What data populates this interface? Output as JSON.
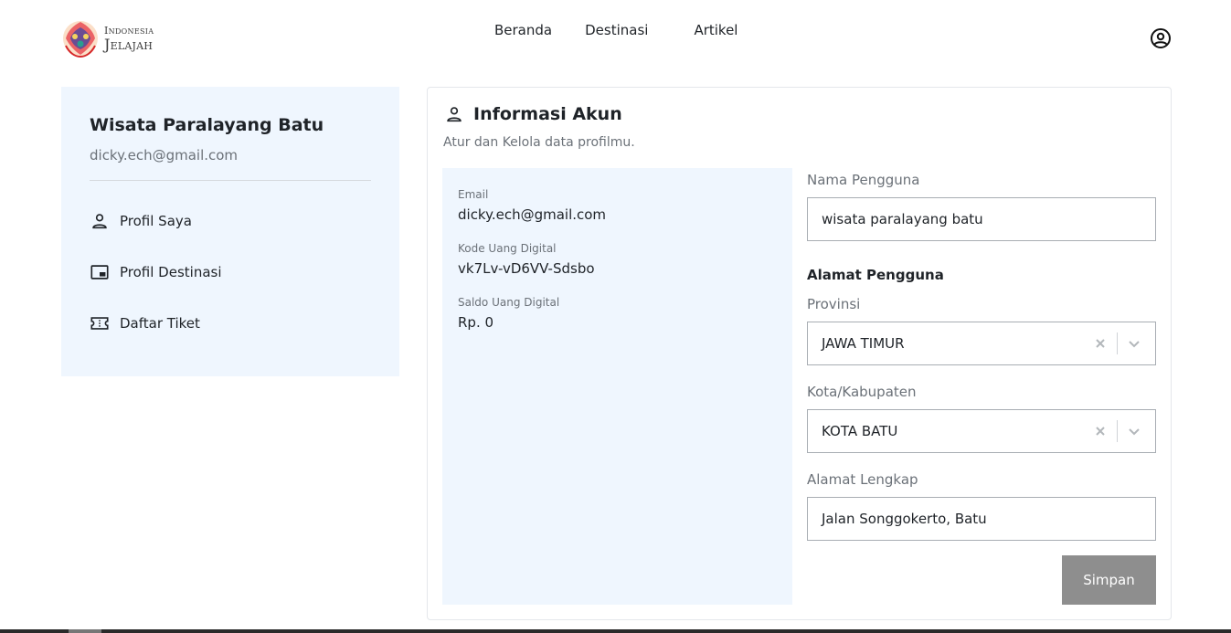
{
  "header": {
    "logo_line1": "Indonesia",
    "logo_line2": "Jelajah",
    "nav": [
      "Beranda",
      "Destinasi",
      "Artikel"
    ]
  },
  "sidebar": {
    "name": "Wisata Paralayang Batu",
    "email": "dicky.ech@gmail.com",
    "items": [
      {
        "label": "Profil Saya",
        "icon": "person-icon"
      },
      {
        "label": "Profil Destinasi",
        "icon": "picture-in-picture-icon"
      },
      {
        "label": "Daftar Tiket",
        "icon": "ticket-icon"
      }
    ]
  },
  "card": {
    "title": "Informasi Akun",
    "subtitle": "Atur dan Kelola data profilmu.",
    "info": [
      {
        "label": "Email",
        "value": "dicky.ech@gmail.com"
      },
      {
        "label": "Kode Uang Digital",
        "value": "vk7Lv-vD6VV-Sdsbo"
      },
      {
        "label": "Saldo Uang Digital",
        "value": "Rp. 0"
      }
    ]
  },
  "form": {
    "username_label": "Nama Pengguna",
    "username_value": "wisata paralayang batu",
    "address_heading": "Alamat Pengguna",
    "province_label": "Provinsi",
    "province_value": "JAWA TIMUR",
    "city_label": "Kota/Kabupaten",
    "city_value": "KOTA BATU",
    "full_address_label": "Alamat Lengkap",
    "full_address_value": "Jalan Songgokerto, Batu",
    "save_label": "Simpan"
  },
  "colors": {
    "panel_bg": "#eff6fe",
    "button_bg": "#8e8e8e",
    "text": "#1f2328",
    "muted": "#6b7178"
  }
}
